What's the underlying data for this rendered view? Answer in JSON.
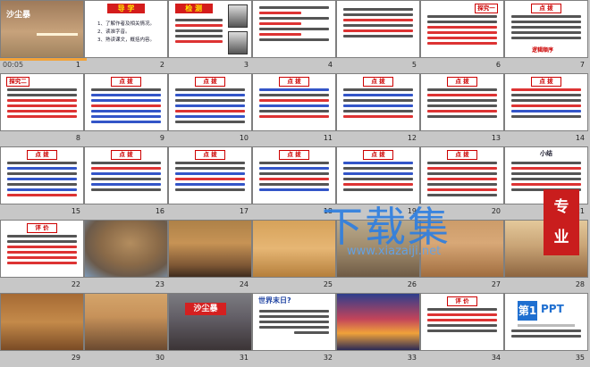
{
  "app": {
    "view": "Slide Sorter"
  },
  "slides": [
    {
      "n": "1",
      "timing": "00:05",
      "title": "沙尘暴"
    },
    {
      "n": "2",
      "title": "导 学",
      "lines": [
        "1、了解作者及相关情况。",
        "2、读准字音。",
        "3、熟读课文，概括内容。"
      ]
    },
    {
      "n": "3",
      "title": "检 测"
    },
    {
      "n": "4"
    },
    {
      "n": "5"
    },
    {
      "n": "6",
      "title": "探究一"
    },
    {
      "n": "7",
      "title": "点 拨",
      "sub": "逻辑顺序"
    },
    {
      "n": "8",
      "title": "探究二"
    },
    {
      "n": "9",
      "title": "点 拨"
    },
    {
      "n": "10",
      "title": "点 拨"
    },
    {
      "n": "11",
      "title": "点 拨"
    },
    {
      "n": "12",
      "title": "点 拨"
    },
    {
      "n": "13",
      "title": "点 拨"
    },
    {
      "n": "14",
      "title": "点 拨"
    },
    {
      "n": "15",
      "title": "点 拨"
    },
    {
      "n": "16",
      "title": "点 拨"
    },
    {
      "n": "17",
      "title": "点 拨"
    },
    {
      "n": "18",
      "title": "点 拨"
    },
    {
      "n": "19",
      "title": "点 拨"
    },
    {
      "n": "20",
      "title": "点 拨"
    },
    {
      "n": "21",
      "title": "小结"
    },
    {
      "n": "22",
      "title": "评 价"
    },
    {
      "n": "23"
    },
    {
      "n": "24"
    },
    {
      "n": "25"
    },
    {
      "n": "26"
    },
    {
      "n": "27"
    },
    {
      "n": "28"
    },
    {
      "n": "29"
    },
    {
      "n": "30"
    },
    {
      "n": "31",
      "label": "沙尘暴"
    },
    {
      "n": "32",
      "title": "世界末日?"
    },
    {
      "n": "33"
    },
    {
      "n": "34",
      "title": "评 价"
    },
    {
      "n": "35",
      "logo_num": "第1",
      "logo_text": "PPT"
    }
  ],
  "watermark": {
    "main": "下载集",
    "url": "www.xiazaiji.net",
    "seal_top": "专",
    "seal_bottom": "业"
  }
}
